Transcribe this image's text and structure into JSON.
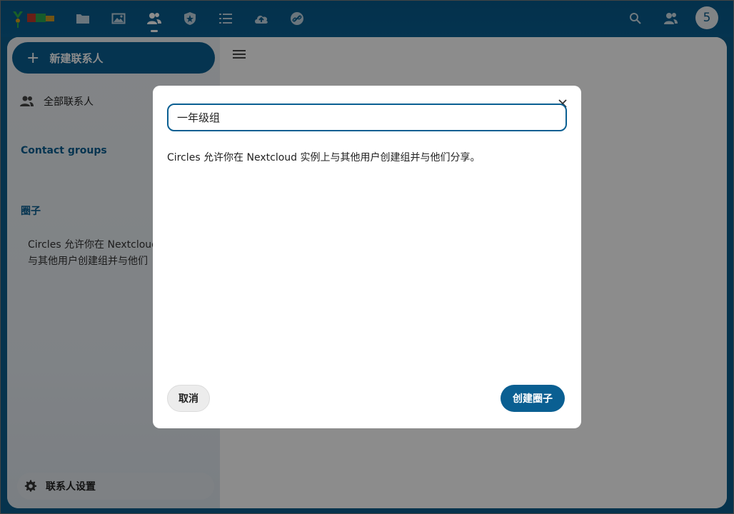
{
  "header": {
    "logo": "logo-icon",
    "apps": [
      {
        "name": "files",
        "icon": "folder-icon"
      },
      {
        "name": "photos",
        "icon": "image-icon"
      },
      {
        "name": "contacts",
        "icon": "contacts-icon",
        "active": true
      },
      {
        "name": "shield",
        "icon": "shield-icon"
      },
      {
        "name": "tasks",
        "icon": "list-icon"
      },
      {
        "name": "upload",
        "icon": "cloud-upload-icon"
      },
      {
        "name": "link",
        "icon": "link-icon"
      }
    ],
    "avatar_initial": "5"
  },
  "sidebar": {
    "new_contact_label": "新建联系人",
    "all_contacts_label": "全部联系人",
    "contact_groups_title": "Contact groups",
    "circles_title": "圈子",
    "circles_desc_line1": "Circles 允许你在 Nextcloud",
    "circles_desc_line2": "与其他用户创建组并与他们",
    "settings_label": "联系人设置"
  },
  "modal": {
    "name_value": "一年级组",
    "description": "Circles 允许你在 Nextcloud 实例上与其他用户创建组并与他们分享。",
    "cancel_label": "取消",
    "create_label": "创建圈子"
  },
  "colors": {
    "primary": "#0a5f92",
    "header_bg": "#07598a",
    "overlay": "rgba(0,0,0,0.45)"
  }
}
